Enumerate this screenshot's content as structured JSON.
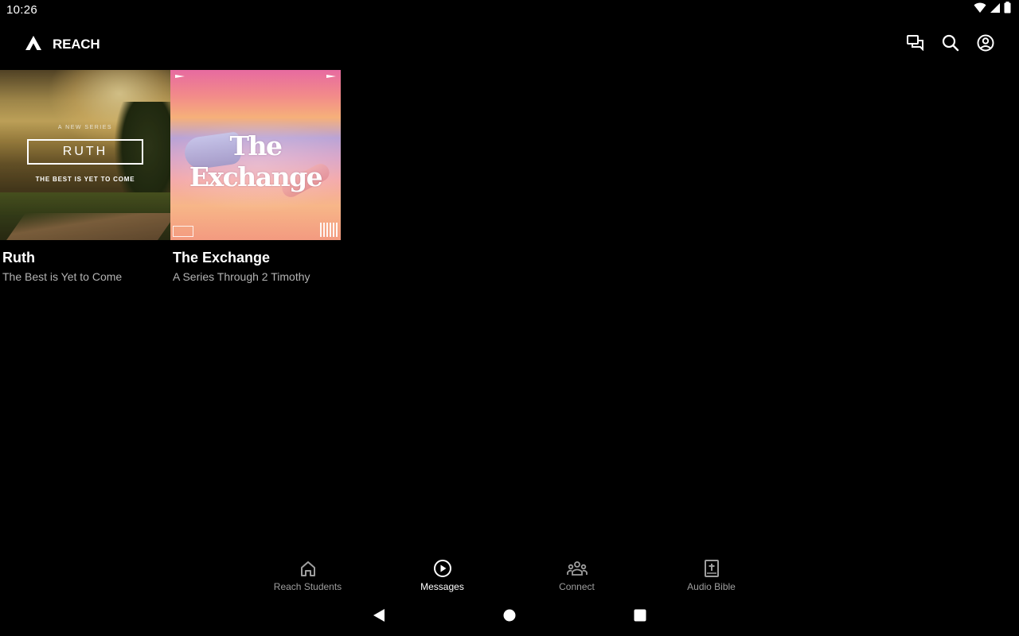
{
  "status_bar": {
    "time": "10:26",
    "icons": [
      "wifi-icon",
      "cell-signal-icon",
      "battery-icon"
    ]
  },
  "app_bar": {
    "logo_icon": "reach-logo-icon",
    "title": "REACH",
    "actions": [
      "chat-icon",
      "search-icon",
      "account-icon"
    ]
  },
  "series": [
    {
      "title": "Ruth",
      "subtitle": "The Best is Yet to Come",
      "art": {
        "kicker": "A NEW SERIES",
        "heading": "RUTH",
        "tagline": "THE BEST IS YET TO COME"
      }
    },
    {
      "title": "The Exchange",
      "subtitle": "A Series Through 2 Timothy",
      "art": {
        "heading": "The Exchange"
      }
    }
  ],
  "bottom_nav": {
    "items": [
      {
        "label": "Reach Students",
        "icon": "home-icon",
        "active": false
      },
      {
        "label": "Messages",
        "icon": "play-circle-icon",
        "active": true
      },
      {
        "label": "Connect",
        "icon": "group-icon",
        "active": false
      },
      {
        "label": "Audio Bible",
        "icon": "bible-icon",
        "active": false
      }
    ]
  },
  "system_nav": [
    "back-icon",
    "home-circle-icon",
    "recents-icon"
  ],
  "colors": {
    "background": "#000000",
    "text_primary": "#ffffff",
    "text_secondary": "#b3b3b3",
    "nav_inactive": "#9e9e9e"
  }
}
